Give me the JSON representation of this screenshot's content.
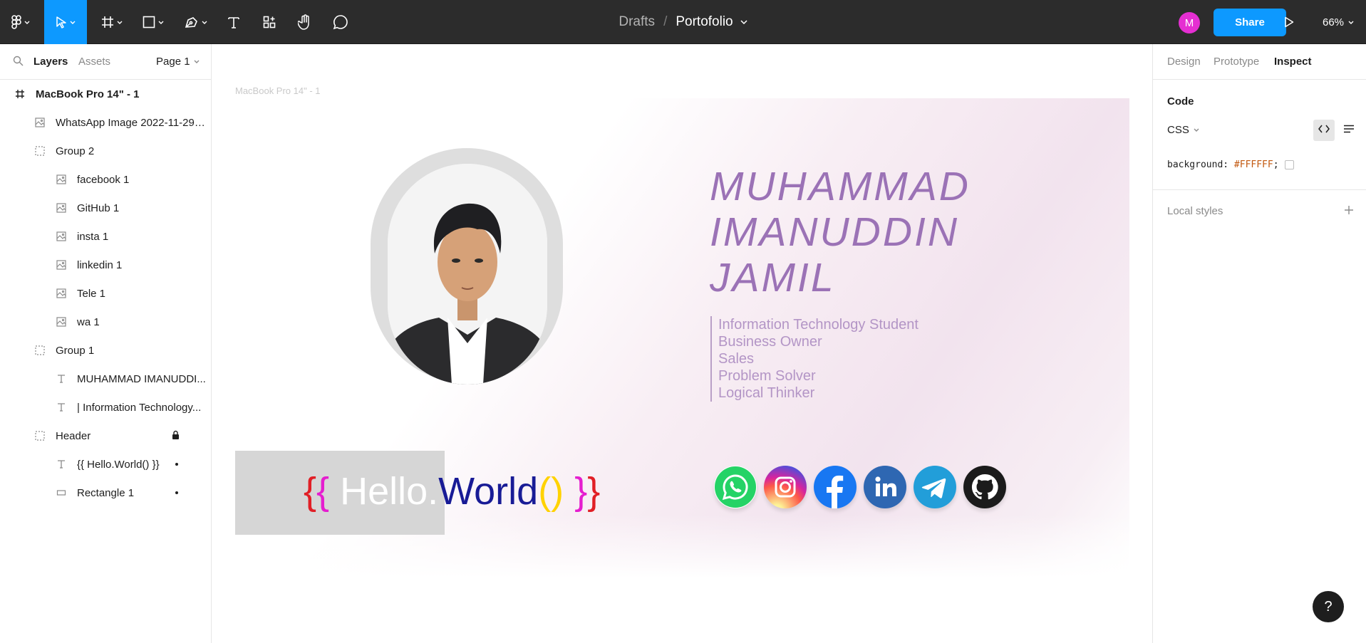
{
  "toolbar": {
    "tools": [
      {
        "name": "main-menu",
        "icon": "figma-logo-icon"
      },
      {
        "name": "move-tool",
        "icon": "cursor-arrow-icon",
        "active": true
      },
      {
        "name": "frame-tool",
        "icon": "frame-hash-icon"
      },
      {
        "name": "shape-tool",
        "icon": "rectangle-icon"
      },
      {
        "name": "pen-tool",
        "icon": "pen-icon"
      },
      {
        "name": "text-tool",
        "icon": "text-t-icon"
      },
      {
        "name": "resources-tool",
        "icon": "components-icon"
      },
      {
        "name": "hand-tool",
        "icon": "hand-icon"
      },
      {
        "name": "comment-tool",
        "icon": "speech-bubble-icon"
      }
    ],
    "breadcrumb_root": "Drafts",
    "breadcrumb_sep": "/",
    "file_name": "Portofolio",
    "avatar_initial": "M",
    "avatar_color": "#e52fd2",
    "share_label": "Share",
    "zoom_label": "66%",
    "accent": "#0d99ff"
  },
  "left_panel": {
    "tabs": [
      "Layers",
      "Assets"
    ],
    "page_selector": "Page 1",
    "layers": [
      {
        "label": "MacBook Pro 14\" - 1",
        "type": "frame",
        "indent": 0
      },
      {
        "label": "WhatsApp Image 2022-11-29 ...",
        "type": "image",
        "indent": 1
      },
      {
        "label": "Group 2",
        "type": "group",
        "indent": 1
      },
      {
        "label": "facebook 1",
        "type": "image",
        "indent": 2
      },
      {
        "label": "GitHub 1",
        "type": "image",
        "indent": 2
      },
      {
        "label": "insta 1",
        "type": "image",
        "indent": 2
      },
      {
        "label": "linkedin 1",
        "type": "image",
        "indent": 2
      },
      {
        "label": "Tele 1",
        "type": "image",
        "indent": 2
      },
      {
        "label": "wa 1",
        "type": "image",
        "indent": 2
      },
      {
        "label": "Group 1",
        "type": "group",
        "indent": 1
      },
      {
        "label": "MUHAMMAD IMANUDDI...",
        "type": "text",
        "indent": 2
      },
      {
        "label": "| Information Technology...",
        "type": "text",
        "indent": 2
      },
      {
        "label": "Header",
        "type": "group",
        "indent": 1,
        "locked": true
      },
      {
        "label": "{{ Hello.World() }}",
        "type": "text",
        "indent": 2,
        "dot": true
      },
      {
        "label": "Rectangle 1",
        "type": "rect",
        "indent": 2,
        "dot": true
      }
    ]
  },
  "canvas": {
    "frame_label": "MacBook Pro 14\" - 1",
    "name_lines": [
      "MUHAMMAD",
      "IMANUDDIN",
      "JAMIL"
    ],
    "roles": [
      "Information Technology Student",
      "Business Owner",
      "Sales",
      "Problem Solver",
      "Logical Thinker"
    ],
    "hello": {
      "open_brace_1": "{",
      "open_brace_2": "{",
      "hello": " Hello.",
      "world": "World",
      "parens": "()",
      "close_brace_1": "}",
      "close_brace_2": "}"
    },
    "socials": [
      {
        "name": "whatsapp",
        "icon": "whatsapp-icon",
        "color": "#25d366"
      },
      {
        "name": "instagram",
        "icon": "instagram-icon",
        "color": "#d6249f"
      },
      {
        "name": "facebook",
        "icon": "facebook-icon",
        "color": "#1877f2"
      },
      {
        "name": "linkedin",
        "icon": "linkedin-icon",
        "color": "#2e67b2"
      },
      {
        "name": "telegram",
        "icon": "telegram-icon",
        "color": "#229ed9"
      },
      {
        "name": "github",
        "icon": "github-icon",
        "color": "#1b1b1b"
      }
    ],
    "name_color": "#9b72b6",
    "roles_color": "#b395c6"
  },
  "right_panel": {
    "tabs": [
      "Design",
      "Prototype",
      "Inspect"
    ],
    "active_tab": "Inspect",
    "code_title": "Code",
    "language": "CSS",
    "code_prop": "background:",
    "code_value": "#FFFFFF",
    "code_end": ";",
    "local_styles": "Local styles"
  },
  "help_label": "?"
}
